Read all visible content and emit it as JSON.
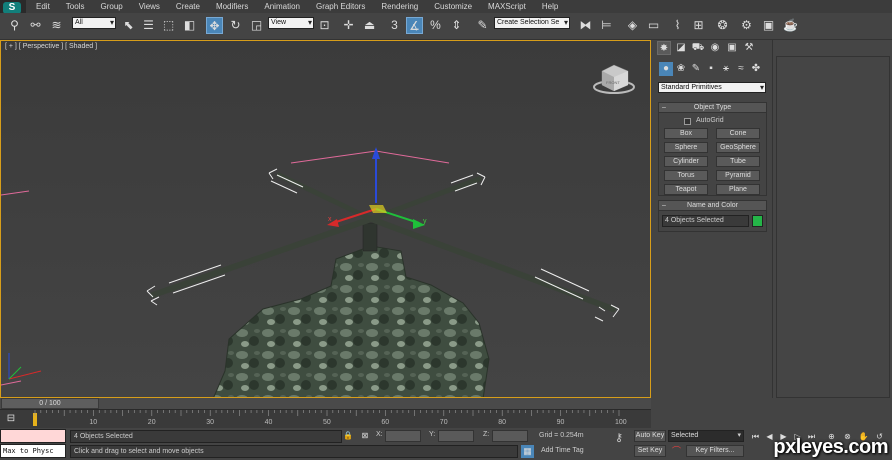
{
  "app": {
    "logo_letter": "S"
  },
  "menu": [
    "Edit",
    "Tools",
    "Group",
    "Views",
    "Create",
    "Modifiers",
    "Animation",
    "Graph Editors",
    "Rendering",
    "Customize",
    "MAXScript",
    "Help"
  ],
  "toolbar": {
    "selection_filter": "All",
    "ref_coord_system": "View",
    "named_selection_set": "Create Selection Se",
    "icons": [
      "link-icon",
      "unlink-icon",
      "bind-space-warp-icon",
      "select-object-icon",
      "select-by-name-icon",
      "rectangle-region-icon",
      "window-crossing-icon",
      "select-move-icon",
      "select-rotate-icon",
      "select-scale-icon",
      "pivot-icon",
      "manipulate-icon",
      "keyboard-shortcut-icon",
      "snap-3d-icon",
      "angle-snap-icon",
      "percent-snap-icon",
      "spinner-snap-icon",
      "edit-named-selection-icon",
      "mirror-icon",
      "align-icon",
      "layer-manager-icon",
      "graphite-ribbon-icon",
      "curve-editor-icon",
      "schematic-view-icon",
      "material-editor-icon",
      "render-setup-icon",
      "rendered-frame-icon",
      "render-production-icon"
    ]
  },
  "viewport": {
    "label": "[ + ] [ Perspective ] [ Shaded ]",
    "viewcube_label": "FRONT"
  },
  "command_panel": {
    "tabs": [
      "create-tab",
      "modify-tab",
      "hierarchy-tab",
      "motion-tab",
      "display-tab",
      "utilities-tab"
    ],
    "subtabs": [
      "geometry-icon",
      "shapes-icon",
      "lights-icon",
      "cameras-icon",
      "helpers-icon",
      "space-warps-icon",
      "systems-icon"
    ],
    "category": "Standard Primitives",
    "object_type": {
      "title": "Object Type",
      "autogrid": "AutoGrid",
      "buttons": [
        "Box",
        "Cone",
        "Sphere",
        "GeoSphere",
        "Cylinder",
        "Tube",
        "Torus",
        "Pyramid",
        "Teapot",
        "Plane"
      ]
    },
    "name_color": {
      "title": "Name and Color",
      "name_value": "4 Objects Selected",
      "swatch_color": "#24b548"
    }
  },
  "time_slider": {
    "position_label": "0 / 100"
  },
  "track_bar": {
    "ticks": [
      "10",
      "20",
      "30",
      "40",
      "50",
      "60",
      "70",
      "80",
      "90",
      "100"
    ]
  },
  "status": {
    "selection_info": "4 Objects Selected",
    "prompt": "Click and drag to select and move objects",
    "coord_labels": [
      "X:",
      "Y:",
      "Z:"
    ],
    "grid": "Grid = 0.254m",
    "add_time_tag": "Add Time Tag",
    "auto_key": "Auto Key",
    "set_key": "Set Key",
    "selection_set": "Selected",
    "key_filters": "Key Filters...",
    "maxscript_listener": "Max to Physc"
  },
  "watermark": "pxleyes.com",
  "colors": {
    "selection_green": "#24b548",
    "active_blue": "#4a86b8",
    "viewport_border": "#d79e1a"
  }
}
